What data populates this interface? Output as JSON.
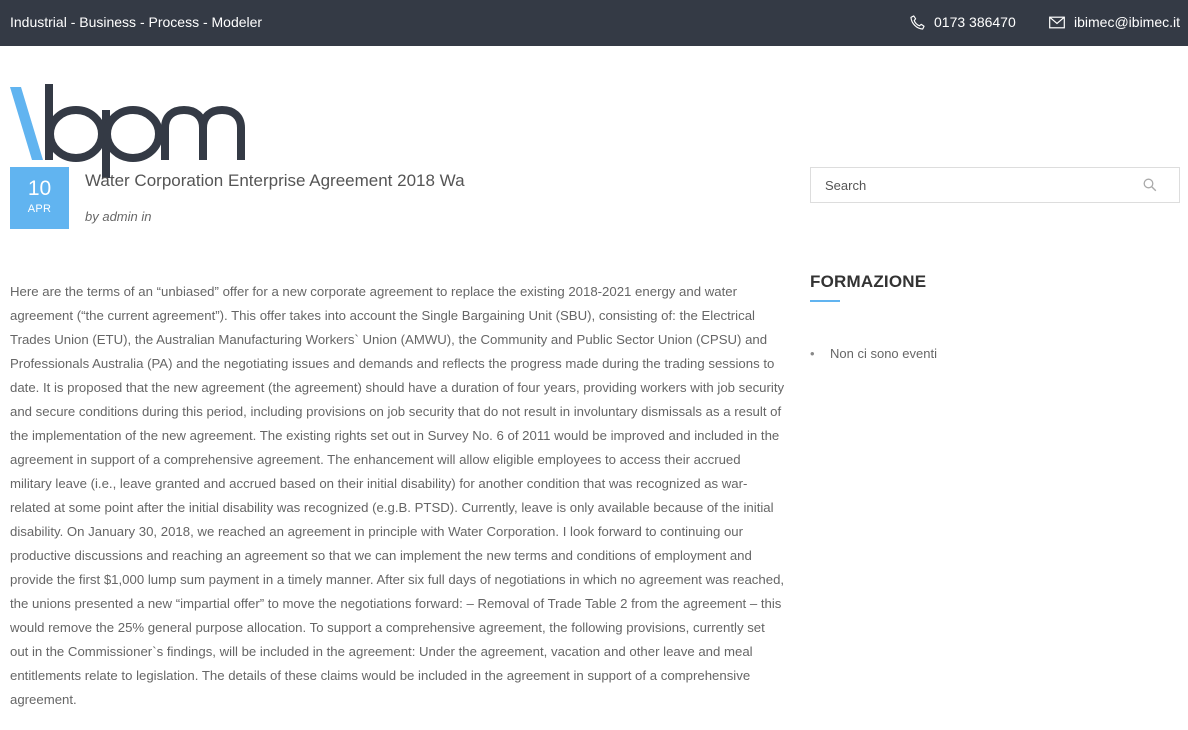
{
  "topbar": {
    "tagline": "Industrial - Business - Process - Modeler",
    "phone": "0173 386470",
    "email": "ibimec@ibimec.it",
    "icons": {
      "phone": "phone-icon",
      "email": "envelope-icon"
    }
  },
  "logo": {
    "text": "\\bpm",
    "accent_color": "#61b4f0",
    "text_color": "#343a45"
  },
  "post": {
    "date_day": "10",
    "date_month": "APR",
    "title": "Water Corporation Enterprise Agreement 2018 Wa",
    "meta": "by admin in",
    "body": "Here are the terms of an “unbiased” offer for a new corporate agreement to replace the existing 2018-2021 energy and water agreement (“the current agreement”). This offer takes into account the Single Bargaining Unit (SBU), consisting of: the Electrical Trades Union (ETU), the Australian Manufacturing Workers` Union (AMWU), the Community and Public Sector Union (CPSU) and Professionals Australia (PA) and the negotiating issues and demands and reflects the progress made during the trading sessions to date. It is proposed that the new agreement (the agreement) should have a duration of four years, providing workers with job security and secure conditions during this period, including provisions on job security that do not result in involuntary dismissals as a result of the implementation of the new agreement. The existing rights set out in Survey No. 6 of 2011 would be improved and included in the agreement in support of a comprehensive agreement. The enhancement will allow eligible employees to access their accrued military leave (i.e., leave granted and accrued based on their initial disability) for another condition that was recognized as war-related at some point after the initial disability was recognized (e.g.B. PTSD). Currently, leave is only available because of the initial disability. On January 30, 2018, we reached an agreement in principle with Water Corporation. I look forward to continuing our productive discussions and reaching an agreement so that we can implement the new terms and conditions of employment and provide the first $1,000 lump sum payment in a timely manner. After six full days of negotiations in which no agreement was reached, the unions presented a new “impartial offer” to move the negotiations forward: – Removal of Trade Table 2 from the agreement – this would remove the 25% general purpose allocation. To support a comprehensive agreement, the following provisions, currently set out in the Commissioner`s findings, will be included in the agreement: Under the agreement, vacation and other leave and meal entitlements relate to legislation. The details of these claims would be included in the agreement in support of a comprehensive agreement."
  },
  "sidebar": {
    "search_placeholder": "Search",
    "search_value": "",
    "widget_title": "FORMAZIONE",
    "events": [
      "Non ci sono eventi"
    ]
  },
  "colors": {
    "topbar_bg": "#343a45",
    "accent": "#61b4f0"
  }
}
